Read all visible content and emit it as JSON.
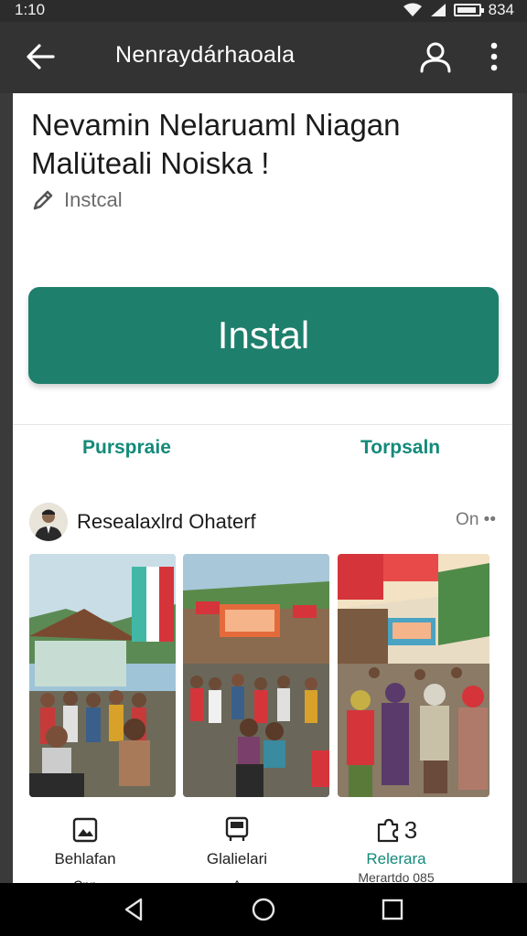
{
  "status_bar": {
    "time": "1:10",
    "battery_text": "834"
  },
  "app_bar": {
    "title": "Nenraydárhaoala"
  },
  "content": {
    "headline": "Nevamin Nelaruaml Niagan Malüteali Noiska !",
    "subtitle": "Instcal",
    "install_label": "Instal",
    "tabs": [
      "Purspraie",
      "Torpsaln"
    ]
  },
  "post": {
    "author": "Resealaxlrd Ohaterf",
    "more_text": "On",
    "photos": [
      {
        "banner": ""
      },
      {
        "banner": ""
      },
      {
        "banner": ""
      }
    ]
  },
  "actions": [
    {
      "icon": "photo-icon",
      "label": "Behlafan",
      "sub": "Cnn"
    },
    {
      "icon": "bus-icon",
      "label": "Glalielari",
      "sub": "A"
    },
    {
      "icon": "puzzle-icon",
      "label": "Relerara",
      "sub": "Merartdo 085",
      "count": "3"
    }
  ],
  "colors": {
    "accent": "#1e7f6c",
    "tab_text": "#138a7a",
    "app_bar": "#333333"
  }
}
